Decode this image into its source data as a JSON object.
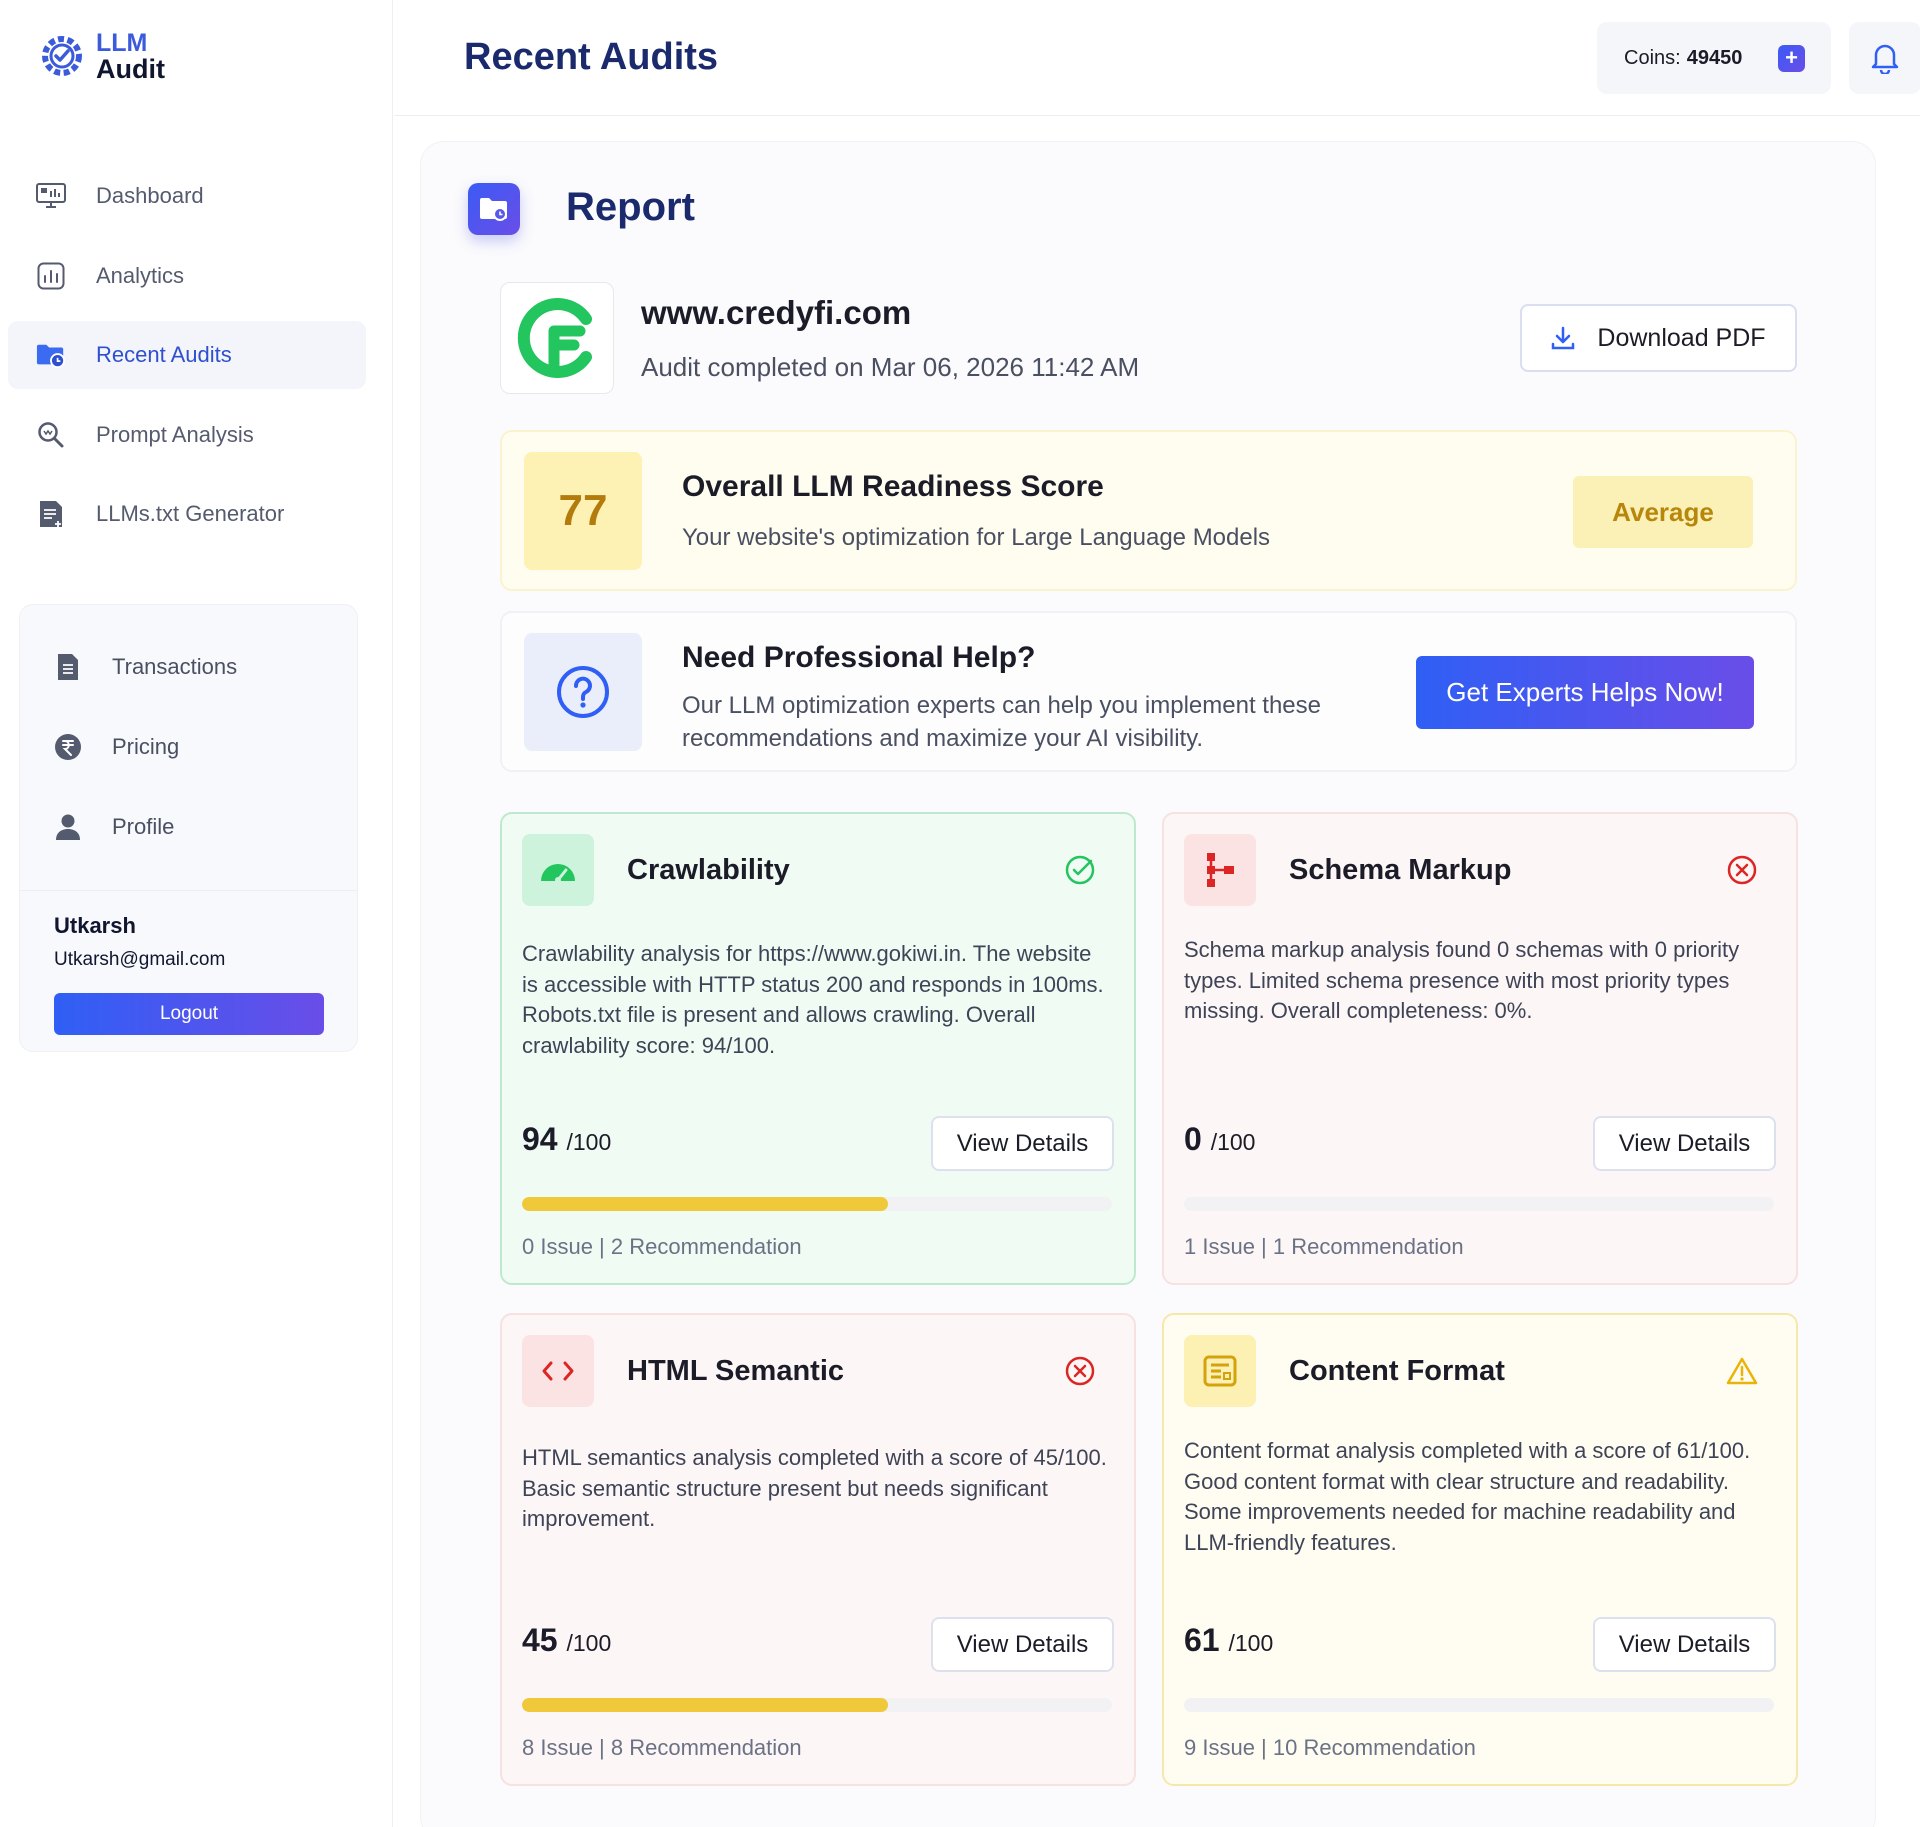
{
  "app": {
    "logo_line1": "LLM",
    "logo_line2": "Audit"
  },
  "sidebar": {
    "nav": [
      {
        "label": "Dashboard",
        "icon": "dashboard-icon"
      },
      {
        "label": "Analytics",
        "icon": "analytics-icon"
      },
      {
        "label": "Recent Audits",
        "icon": "folder-clock-icon",
        "active": true
      },
      {
        "label": "Prompt Analysis",
        "icon": "search-icon"
      },
      {
        "label": "LLMs.txt Generator",
        "icon": "document-icon"
      }
    ],
    "secondary": [
      {
        "label": "Transactions",
        "icon": "receipt-icon"
      },
      {
        "label": "Pricing",
        "icon": "rupee-icon"
      },
      {
        "label": "Profile",
        "icon": "user-icon"
      }
    ],
    "user": {
      "name": "Utkarsh",
      "email": "Utkarsh@gmail.com"
    },
    "logout_label": "Logout"
  },
  "header": {
    "title": "Recent Audits",
    "coins_label": "Coins:",
    "coins_value": "49450"
  },
  "report": {
    "title": "Report",
    "site": "www.credyfi.com",
    "completed": "Audit completed on Mar 06, 2026 11:42 AM",
    "download_label": "Download PDF",
    "score": {
      "value": "77",
      "title": "Overall LLM Readiness Score",
      "subtitle": "Your website's optimization for Large Language Models",
      "badge": "Average"
    },
    "help": {
      "title": "Need Professional Help?",
      "subtitle": "Our LLM optimization experts can help you implement these recommendations and maximize your AI visibility.",
      "button": "Get Experts Helps Now!"
    }
  },
  "metrics": [
    {
      "title": "Crawlability",
      "desc": "Crawlability analysis for https://www.gokiwi.in. The website is accessible with HTTP status 200 and responds in 100ms. Robots.txt file is present and allows crawling. Overall crawlability score: 94/100.",
      "score": "94",
      "out_of": "/100",
      "button": "View Details",
      "progress": 0.62,
      "issues": "0 Issue | 2 Recommendation",
      "status": "pass",
      "theme": "green"
    },
    {
      "title": "Schema Markup",
      "desc": "Schema markup analysis found 0 schemas with 0 priority types. Limited schema presence with most priority types missing. Overall completeness: 0%.",
      "score": "0",
      "out_of": "/100",
      "button": "View Details",
      "progress": 0,
      "issues": "1 Issue | 1 Recommendation",
      "status": "fail",
      "theme": "red"
    },
    {
      "title": "HTML Semantic",
      "desc": "HTML semantics analysis completed with a score of 45/100. Basic semantic structure present but needs significant improvement.",
      "score": "45",
      "out_of": "/100",
      "button": "View Details",
      "progress": 0.62,
      "issues": "8 Issue | 8 Recommendation",
      "status": "fail",
      "theme": "red"
    },
    {
      "title": "Content Format",
      "desc": "Content format analysis completed with a score of 61/100. Good content format with clear structure and readability. Some improvements needed for machine readability and LLM-friendly features.",
      "score": "61",
      "out_of": "/100",
      "button": "View Details",
      "progress": 0,
      "issues": "9 Issue | 10 Recommendation",
      "status": "warning",
      "theme": "yellow"
    }
  ],
  "colors": {
    "accent": "#2f5ff5",
    "accent2": "#6a4de8",
    "title": "#1a2a6c",
    "success": "#22c55e",
    "danger": "#dc2626",
    "warning": "#eab308",
    "progress": "#f0c93b"
  }
}
